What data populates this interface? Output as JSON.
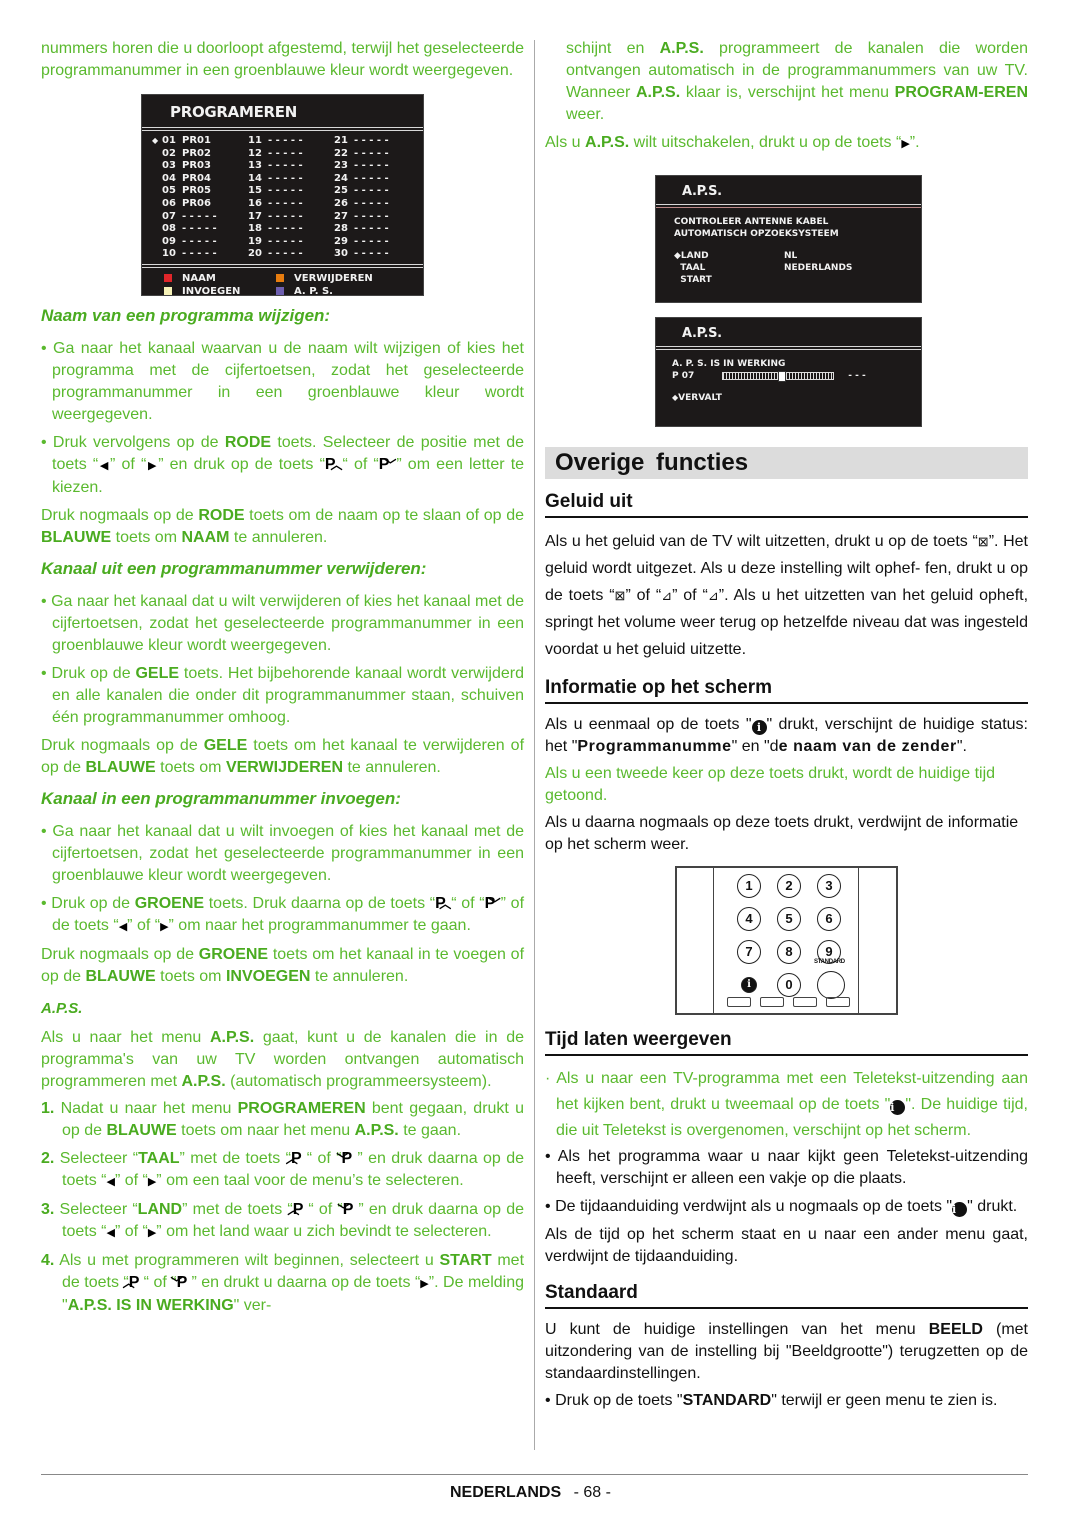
{
  "colors": {
    "text_green": "#5ab92e",
    "bold_green": "#4aab20",
    "osd_bg": "#1c1919",
    "section_bar": "#dcdcdc"
  },
  "left": {
    "intro": "nummers horen die u doorloopt afgestemd, terwijl het geselecteerde programmanummer in een groenblauwe kleur wordt weergegeven.",
    "prog_menu": {
      "title": "PROGRAMEREN",
      "columns": [
        [
          [
            "01",
            "PR01"
          ],
          [
            "02",
            "PR02"
          ],
          [
            "03",
            "PR03"
          ],
          [
            "04",
            "PR04"
          ],
          [
            "05",
            "PR05"
          ],
          [
            "06",
            "PR06"
          ],
          [
            "07",
            "- - - - -"
          ],
          [
            "08",
            "- - - - -"
          ],
          [
            "09",
            "- - - - -"
          ],
          [
            "10",
            "- - - - -"
          ]
        ],
        [
          [
            "11",
            "- - - - -"
          ],
          [
            "12",
            "- - - - -"
          ],
          [
            "13",
            "- - - - -"
          ],
          [
            "14",
            "- - - - -"
          ],
          [
            "15",
            "- - - - -"
          ],
          [
            "16",
            "- - - - -"
          ],
          [
            "17",
            "- - - - -"
          ],
          [
            "18",
            "- - - - -"
          ],
          [
            "19",
            "- - - - -"
          ],
          [
            "20",
            "- - - - -"
          ]
        ],
        [
          [
            "21",
            "- - - - -"
          ],
          [
            "22",
            "- - - - -"
          ],
          [
            "23",
            "- - - - -"
          ],
          [
            "24",
            "- - - - -"
          ],
          [
            "25",
            "- - - - -"
          ],
          [
            "26",
            "- - - - -"
          ],
          [
            "27",
            "- - - - -"
          ],
          [
            "28",
            "- - - - -"
          ],
          [
            "29",
            "- - - - -"
          ],
          [
            "30",
            "- - - - -"
          ]
        ]
      ],
      "legend": [
        {
          "label": "NAAM",
          "color": "#e0262a"
        },
        {
          "label": "VERWIJDEREN",
          "color": "#e87d0f"
        },
        {
          "label": "INVOEGEN",
          "color": "#f6f2b8"
        },
        {
          "label": "A. P. S.",
          "color": "#6e5fb0"
        }
      ]
    },
    "naam": {
      "heading": "Naam van een programma wijzigen:",
      "b1": "Ga naar het kanaal waarvan u de naam wilt wijzigen of kies het programma met de cijfertoetsen, zodat het geselecteerde programmanummer in een groenblauwe kleur wordt weergegeven.",
      "b2_pre": "Druk vervolgens op de ",
      "b2_key": "RODE",
      "b2_mid": " toets. Selecteer de positie met de toets “",
      "b2_mid2": "” of “",
      "b2_mid3": "” en druk op de toets “",
      "b2_mid4": "“ of “",
      "b2_end": "” om een letter te kiezen.",
      "p_pre": "Druk nogmaals op de ",
      "p_k1": "RODE",
      "p_mid": " toets om de naam op te slaan of op de ",
      "p_k2": "BLAUWE",
      "p_mid2": " toets om ",
      "p_k3": "NAAM",
      "p_end": " te annuleren."
    },
    "verwijderen": {
      "heading": "Kanaal uit een programmanummer verwijderen:",
      "b1": "Ga naar het kanaal dat u wilt verwijderen of kies het kanaal met de cijfertoetsen, zodat het geselecteerde programmanummer in een groenblauwe kleur wordt weergegeven.",
      "b2_pre": "Druk op de ",
      "b2_key": "GELE",
      "b2_end": " toets. Het bijbehorende kanaal wordt verwijderd en alle kanalen die onder dit programmanummer staan, schuiven één programmanummer omhoog.",
      "p_pre": "Druk nogmaals op de ",
      "p_k1": "GELE",
      "p_mid": " toets om het kanaal te verwijderen of op de ",
      "p_k2": "BLAUWE",
      "p_mid2": " toets om ",
      "p_k3": "VERWIJDEREN",
      "p_end": " te annuleren."
    },
    "invoegen": {
      "heading": "Kanaal in een programmanummer invoegen:",
      "b1": "Ga naar het kanaal dat u wilt invoegen of kies het kanaal met de cijfertoetsen, zodat het geselecteerde programmanummer in een groenblauwe kleur wordt weergegeven.",
      "b2_pre": "Druk op de ",
      "b2_key": "GROENE",
      "b2_mid": " toets. Druk daarna op de toets “",
      "b2_mid2": "“ of “",
      "b2_mid3": "” of de toets “",
      "b2_mid4": "” of “",
      "b2_end": "” om naar het programmanummer te gaan.",
      "p_pre": "Druk nogmaals op de ",
      "p_k1": "GROENE",
      "p_mid": " toets om het kanaal in te voegen of op de ",
      "p_k2": "BLAUWE",
      "p_mid2": " toets om ",
      "p_k3": "INVOEGEN",
      "p_end": " te annuleren."
    },
    "aps": {
      "heading": "A.P.S.",
      "intro_pre": "Als u naar het menu ",
      "intro_k1": "A.P.S.",
      "intro_mid": " gaat, kunt u de kanalen die in de programma's van uw TV worden ontvangen automatisch programmeren met ",
      "intro_k2": "A.P.S.",
      "intro_end": " (automatisch programmeersysteem).",
      "s1_num": "1.",
      "s1_pre": "Nadat u naar het menu ",
      "s1_k1": "PROGRAMEREN",
      "s1_mid": " bent gegaan, drukt u op de ",
      "s1_k2": "BLAUWE",
      "s1_mid2": " toets om naar het menu ",
      "s1_k3": "A.P.S.",
      "s1_end": " te gaan.",
      "s2_num": "2.",
      "s2_pre": "Selecteer “",
      "s2_k": "TAAL",
      "s2_mid": "” met de toets “",
      "s2_mid2": "“ of “",
      "s2_mid3": "” en druk daarna op de toets “",
      "s2_mid4": "” of “",
      "s2_end": "” om een taal voor de menu’s te selecteren.",
      "s3_num": "3.",
      "s3_pre": "Selecteer “",
      "s3_k": "LAND",
      "s3_mid": "” met de toets “",
      "s3_mid2": "“ of “",
      "s3_mid3": "” en druk daarna op de toets “",
      "s3_mid4": "” of “",
      "s3_end": "” om het land waar u zich bevindt te selecteren.",
      "s4_num": "4.",
      "s4_pre": "Als u met programmeren wilt beginnen, selecteert u ",
      "s4_k": "START",
      "s4_mid": " met de toets “",
      "s4_mid2": "“ of “",
      "s4_mid3": "” en drukt u daarna op de toets “",
      "s4_mid4": "”. De melding \"",
      "s4_k2": "A.P.S. IS IN WERKING",
      "s4_end": "\" ver-"
    }
  },
  "right": {
    "cont_pre": "schijnt en ",
    "cont_k1": "A.P.S.",
    "cont_mid": " programmeert de kanalen die worden ontvangen automatisch in de programmanummers van uw TV. Wanneer ",
    "cont_k2": "A.P.S.",
    "cont_mid2": " klaar is, verschijnt het menu ",
    "cont_k3": "PROGRAM-EREN",
    "cont_end": " weer.",
    "off_pre": "Als u ",
    "off_k": "A.P.S.",
    "off_mid": " wilt uitschakelen, drukt u op de toets “",
    "off_end": "”.",
    "aps_menu1": {
      "title": "A.P.S.",
      "line1": "CONTROLEER  ANTENNE  KABEL",
      "line2": "AUTOMATISCH  OPZOEKSYSTEEM",
      "rows": [
        {
          "label": "LAND",
          "value": "NL"
        },
        {
          "label": "TAAL",
          "value": "NEDERLANDS"
        },
        {
          "label": "START",
          "value": ""
        }
      ]
    },
    "aps_menu2": {
      "title": "A.P.S.",
      "status": "A.  P.  S.  IS  IN  WERKING",
      "program": "P  07",
      "progress_fraction": 0.5,
      "value": "- - -",
      "option": "VERVALT"
    },
    "section_title": "Overige  functies",
    "geluid": {
      "heading": "Geluid uit",
      "p1": "Als u het geluid van de TV wilt uitzetten, drukt u op de toets",
      "p2_a": "“",
      "p2_b": "”. Het geluid wordt uitgezet. Als u deze instelling wilt ophef-",
      "p3_a": "fen, drukt u op de toets “",
      "p3_b": "” of “",
      "p3_c": "” of “",
      "p3_d": "”. Als u het uitzetten van het geluid opheft, springt het volume weer terug op hetzelfde niveau dat was ingesteld voordat u het geluid uitzette."
    },
    "info": {
      "heading": "Informatie op het scherm",
      "p1_pre": "Als u eenmaal op de toets \"",
      "p1_mid": "\" drukt, verschijnt de huidige status: het \"",
      "p1_k1": "Programmanumme",
      "p1_mid2": "\" en \"d",
      "p1_k2": "e naam van de zender",
      "p1_end": "\".",
      "p2": "Als u een tweede keer op deze toets drukt, wordt de huidige tijd getoond.",
      "p3": "Als u daarna nogmaals op deze toets drukt, verdwijnt de informatie op het scherm weer."
    },
    "remote": {
      "keys": [
        "1",
        "2",
        "3",
        "4",
        "5",
        "6",
        "7",
        "8",
        "9",
        "i",
        "0",
        ""
      ],
      "standard_label": "STANDARD"
    },
    "tijd": {
      "heading": "Tijd laten weergeven",
      "b1_pre": "Als u naar een TV-programma met een Teletekst-uitzending aan het kijken bent, drukt u tweemaal op de toets \"",
      "b1_end": "\". De huidige tijd, die uit Teletekst is overgenomen, verschijnt op het scherm.",
      "b2": "Als het programma waar u naar kijkt geen Teletekst-uitzending heeft, verschijnt er alleen een vakje op die plaats.",
      "b3_pre": "De tijdaanduiding verdwijnt als u nogmaals op de toets \"",
      "b3_end": "\" drukt.",
      "p": "Als de tijd op het scherm staat en u naar een ander menu gaat, verdwijnt de tijdaanduiding."
    },
    "standaard": {
      "heading": "Standaard",
      "p_pre": "U kunt de huidige instellingen van het menu ",
      "p_k": "BEELD",
      "p_end": " (met uitzondering van de instelling bij \"Beeldgrootte\") terugzetten op de standaardinstellingen.",
      "b_pre": "Druk op de toets \"",
      "b_k": "STANDARD",
      "b_end": "\" terwijl er geen menu te zien is."
    }
  },
  "footer": {
    "language": "NEDERLANDS",
    "page": "- 68 -"
  },
  "glyphs": {
    "bullet": "•",
    "tri_left": "◀",
    "tri_right": "▶",
    "p": "P",
    "chev_up": "︿",
    "chev_down": "﹀",
    "mute": "🔇",
    "vol_down": "⊿",
    "vol_up": "⊿",
    "info": "i",
    "cursor": "◆"
  }
}
